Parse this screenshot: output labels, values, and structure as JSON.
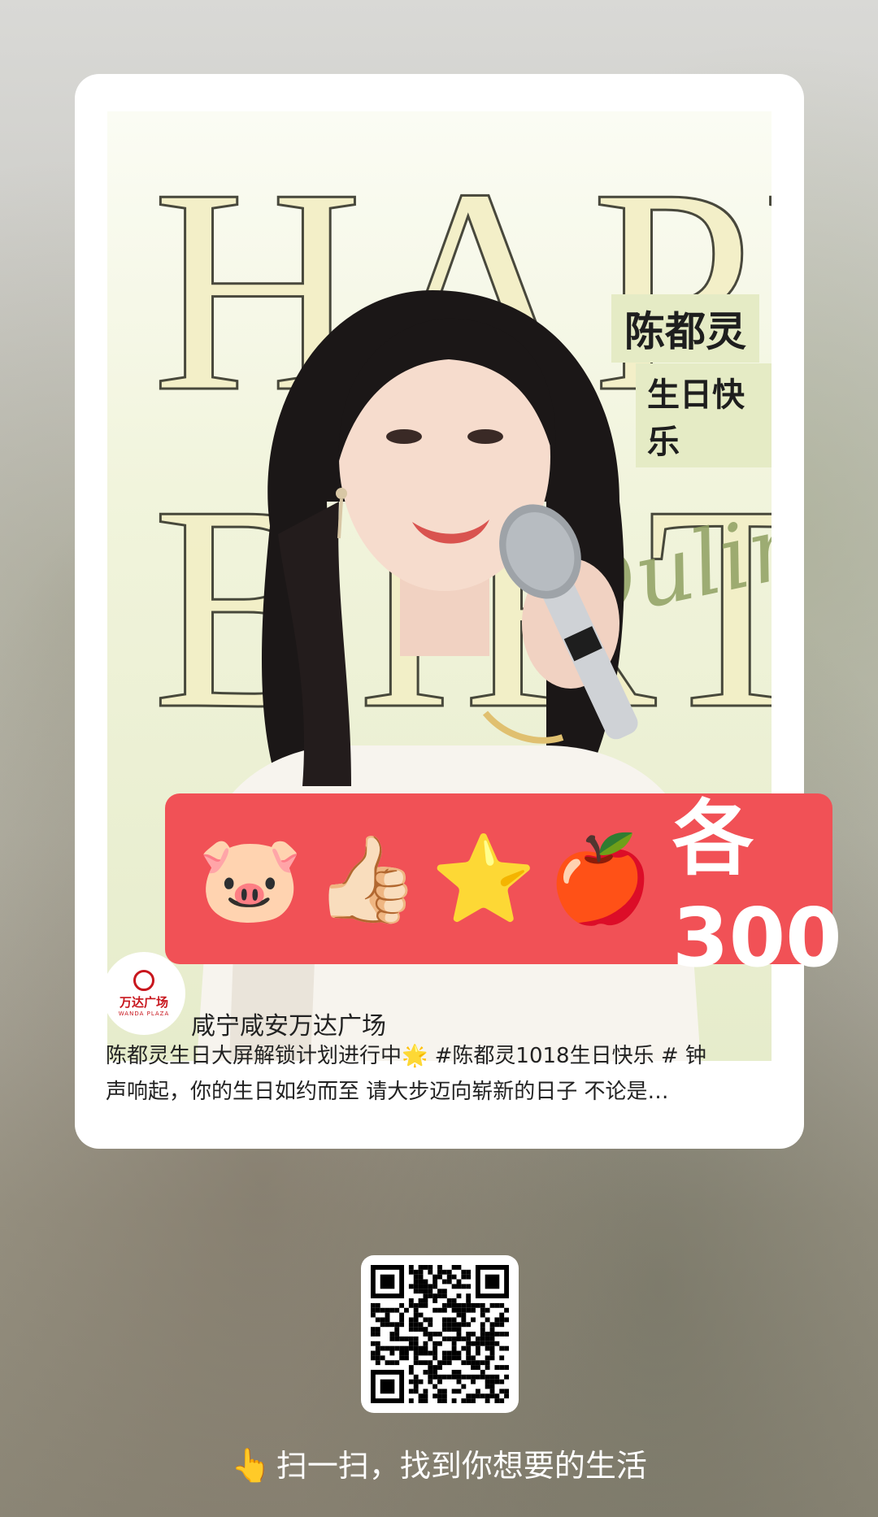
{
  "poster": {
    "name_label": "陈都灵",
    "wish_label": "生日快乐",
    "bg_word_top": "HAPPY",
    "bg_word_bottom": "BIRTHDAY",
    "script_text": "Duling"
  },
  "price_banner": {
    "emojis": [
      "🐷",
      "👍🏻",
      "⭐",
      "🍎"
    ],
    "emoji_names": [
      "pig-face-icon",
      "thumbs-up-icon",
      "star-icon",
      "apple-icon"
    ],
    "price_text": "各300",
    "color": "#f15156"
  },
  "post": {
    "brand_logo_text": "万达广场",
    "brand_logo_sub": "WANDA PLAZA",
    "author": "咸宁咸安万达广场",
    "caption_line1": "陈都灵生日大屏解锁计划进行中🌟 #陈都灵1018生日快乐 # 钟",
    "caption_line2": "声响起，你的生日如约而至 请大步迈向崭新的日子 不论是…"
  },
  "footer": {
    "hint_icon": "👆",
    "hint_text": "扫一扫，找到你想要的生活"
  }
}
